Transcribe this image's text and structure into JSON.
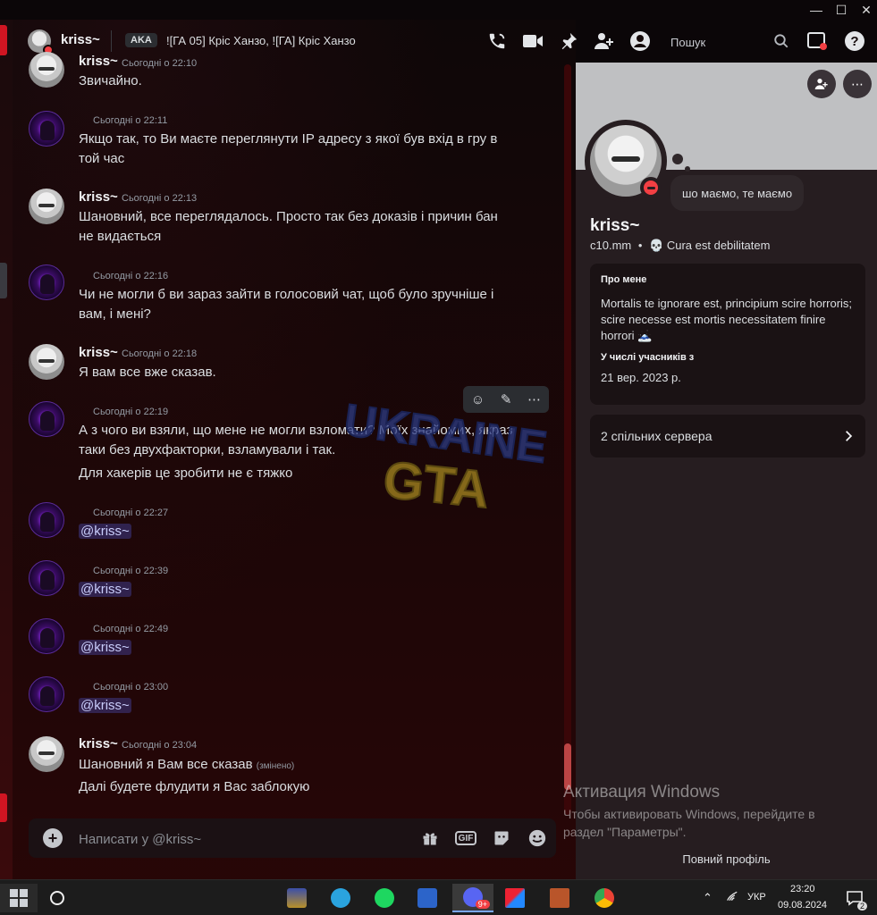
{
  "window": {
    "minimize": "—",
    "maximize": "☐",
    "close": "✕"
  },
  "header": {
    "name": "kriss~",
    "aka_label": "AKA",
    "aka_names": "![ГА 05] Кріс Ханзо, ![ГА] Кріс Ханзо",
    "search_placeholder": "Пошук",
    "icons": [
      "voice-call-icon",
      "video-call-icon",
      "pin-icon",
      "add-friend-icon",
      "profile-icon",
      "search-icon",
      "inbox-icon",
      "help-icon"
    ]
  },
  "messages": [
    {
      "author": "kriss~",
      "time": "Сьогодні о 22:10",
      "lines": [
        "Звичайно."
      ]
    },
    {
      "author": "",
      "time": "Сьогодні о 22:11",
      "lines": [
        "Якщо так, то Ви маєте переглянути IP адресу з якої був вхід в гру в той час"
      ]
    },
    {
      "author": "kriss~",
      "time": "Сьогодні о 22:13",
      "lines": [
        "Шановний, все переглядалось. Просто так без доказів і причин бан не видається"
      ]
    },
    {
      "author": "",
      "time": "Сьогодні о 22:16",
      "lines": [
        "Чи не могли б ви зараз зайти в голосовий чат, щоб було зручніше і вам, і мені?"
      ]
    },
    {
      "author": "kriss~",
      "time": "Сьогодні о 22:18",
      "lines": [
        "Я вам все вже сказав."
      ]
    },
    {
      "author": "",
      "time": "Сьогодні о 22:19",
      "lines": [
        "А з чого ви взяли, що мене не могли взломати? Моїх знайомих, якраз таки без двухфакторки, взламували і так.",
        "Для хакерів це зробити не є тяжко"
      ]
    },
    {
      "author": "",
      "time": "Сьогодні о 22:27",
      "mention": "@kriss~"
    },
    {
      "author": "",
      "time": "Сьогодні о 22:39",
      "mention": "@kriss~"
    },
    {
      "author": "",
      "time": "Сьогодні о 22:49",
      "mention": "@kriss~"
    },
    {
      "author": "",
      "time": "Сьогодні о 23:00",
      "mention": "@kriss~"
    },
    {
      "author": "kriss~",
      "time": "Сьогодні о 23:04",
      "lines": [
        "Шановний я Вам все сказав",
        "Далі будете флудити я Вас заблокую"
      ],
      "edited": "(змінено)"
    }
  ],
  "watermark": {
    "line1": "UKRAINE",
    "line2": "GTA"
  },
  "composer": {
    "placeholder": "Написати у @kriss~",
    "plus": "+",
    "gif_label": "GIF"
  },
  "profile": {
    "status_bubble": "шо маємо, те маємо",
    "name": "kriss~",
    "username": "c10.mm",
    "custom_status": "💀 Cura est debilitatem",
    "about_header": "Про мене",
    "about_text": "Mortalis te ignorare est, principium scire horroris; scire necesse est mortis necessitatem finire horrori 🗻",
    "member_since_header": "У числі учасників з",
    "member_since": "21 вер. 2023 р.",
    "mutual_servers": "2 спільних сервера",
    "full_profile": "Повний профіль"
  },
  "activation": {
    "title": "Активация Windows",
    "text1": "Чтобы активировать Windows, перейдите в",
    "text2": "раздел \"Параметры\"."
  },
  "taskbar": {
    "lang": "УКР",
    "time": "23:20",
    "date": "09.08.2024",
    "discord_badge": "9+",
    "notifications": "2"
  },
  "colors": {
    "accent_red": "#d01522",
    "dnd": "#f23f43",
    "mention_bg": "#5865f2"
  }
}
